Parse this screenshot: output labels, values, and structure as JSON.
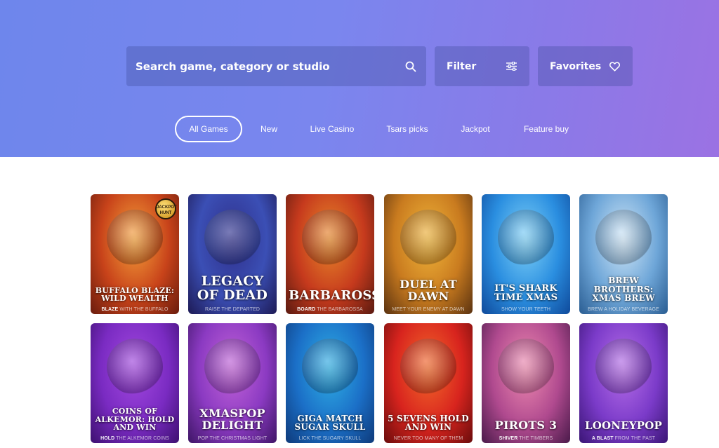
{
  "search": {
    "placeholder": "Search game, category or studio",
    "icon": "search-icon"
  },
  "filter": {
    "label": "Filter",
    "icon": "sliders-icon"
  },
  "favorites": {
    "label": "Favorites",
    "icon": "heart-icon"
  },
  "tabs": [
    {
      "label": "All Games",
      "active": true
    },
    {
      "label": "New",
      "active": false
    },
    {
      "label": "Live Casino",
      "active": false
    },
    {
      "label": "Tsars picks",
      "active": false
    },
    {
      "label": "Jackpot",
      "active": false
    },
    {
      "label": "Feature buy",
      "active": false
    }
  ],
  "games": [
    {
      "title": "BUFFALO BLAZE: WILD WEALTH",
      "tag_hl": "BLAZE",
      "tag_rest": " WITH THE BUFFALO",
      "badge": "JACKPOT HUNT",
      "colors": [
        "#f5a13a",
        "#c8431a",
        "#6a1c0d"
      ]
    },
    {
      "title": "LEGACY OF DEAD",
      "tag_hl": "",
      "tag_rest": "RAISE THE DEPARTED",
      "colors": [
        "#2f2f8a",
        "#3b4fb5",
        "#1d1a55"
      ]
    },
    {
      "title": "BARBAROSSA",
      "tag_hl": "BOARD",
      "tag_rest": " THE BARBAROSSA",
      "colors": [
        "#e8892a",
        "#c63a1d",
        "#5a1a10"
      ]
    },
    {
      "title": "DUEL AT DAWN",
      "tag_hl": "",
      "tag_rest": "MEET YOUR ENEMY AT DAWN",
      "colors": [
        "#f0b53a",
        "#c97b1f",
        "#5a3210"
      ]
    },
    {
      "title": "IT'S SHARK TIME XMAS",
      "tag_hl": "",
      "tag_rest": "SHOW YOUR TEETH",
      "colors": [
        "#7fd1f7",
        "#2a8ee0",
        "#0f4a9b"
      ]
    },
    {
      "title": "BREW BROTHERS: XMAS BREW",
      "tag_hl": "",
      "tag_rest": "BREW A HOLIDAY BEVERAGE",
      "colors": [
        "#cfe6f7",
        "#6ea6d8",
        "#2a5d92"
      ]
    },
    {
      "title": "COINS OF ALKEMOR: HOLD AND WIN",
      "tag_hl": "HOLD",
      "tag_rest": " THE ALKEMOR COINS",
      "colors": [
        "#a349e0",
        "#7a2bc2",
        "#3d1070"
      ]
    },
    {
      "title": "XMASPOP DELIGHT",
      "tag_hl": "",
      "tag_rest": "POP THE CHRISTMAS LIGHT",
      "colors": [
        "#c263d8",
        "#8b3ac2",
        "#3e1566"
      ]
    },
    {
      "title": "GIGA MATCH SUGAR SKULL",
      "tag_hl": "",
      "tag_rest": "LICK THE SUGARY SKULL",
      "colors": [
        "#2fb0e5",
        "#1b6fc7",
        "#0e3a7a"
      ]
    },
    {
      "title": "5 SEVENS HOLD AND WIN",
      "tag_hl": "",
      "tag_rest": "NEVER TOO MANY OF THEM",
      "colors": [
        "#f26a2a",
        "#d8241e",
        "#6a0c0c"
      ]
    },
    {
      "title": "PIROTS 3",
      "tag_hl": "SHIVER",
      "tag_rest": " THE TIMBERS",
      "colors": [
        "#ef8bb0",
        "#b04a8f",
        "#4a1a4a"
      ]
    },
    {
      "title": "LOONEYPOP",
      "tag_hl": "A BLAST",
      "tag_rest": " FROM THE PAST",
      "colors": [
        "#b66ee8",
        "#7b3bc9",
        "#3a1575"
      ]
    }
  ]
}
